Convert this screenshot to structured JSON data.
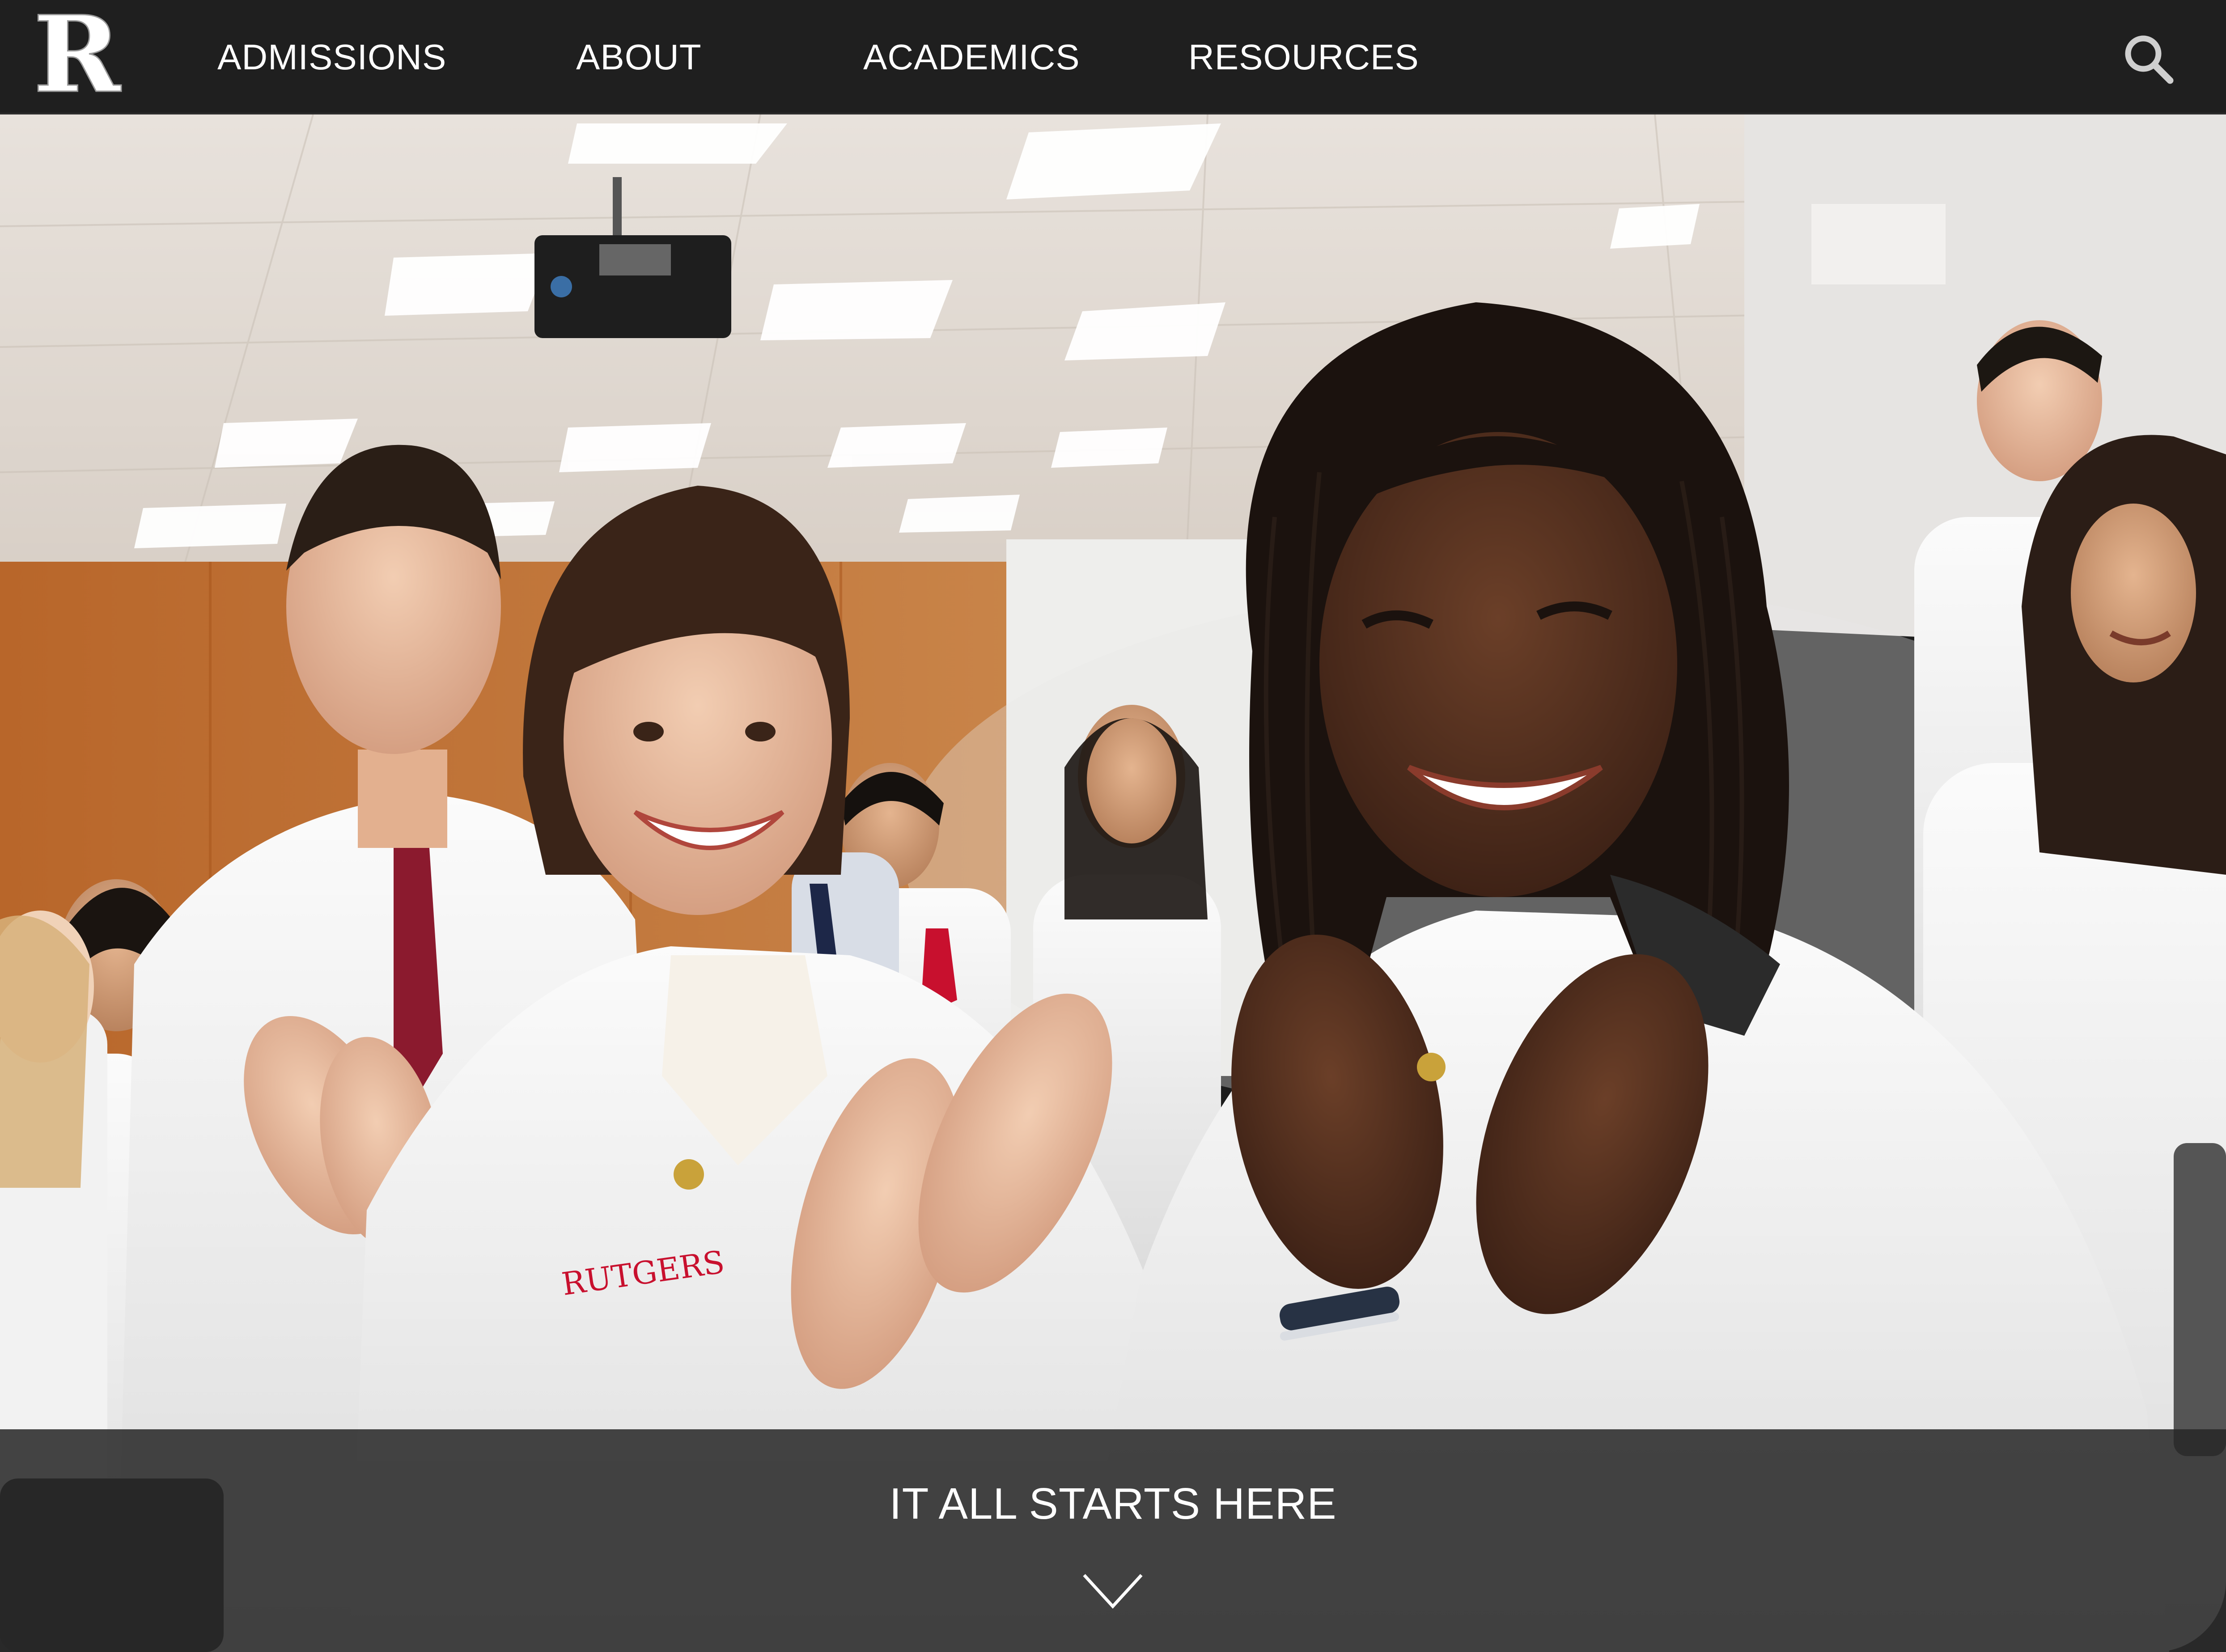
{
  "brand": {
    "logo_letter": "R",
    "logo_icon": "rutgers-r-logo"
  },
  "nav": {
    "items": [
      {
        "label": "ADMISSIONS"
      },
      {
        "label": "ABOUT"
      },
      {
        "label": "ACADEMICS"
      },
      {
        "label": "RESOURCES"
      }
    ],
    "search_icon": "search-icon"
  },
  "hero": {
    "image_subject": "photo",
    "caption": "IT ALL STARTS HERE",
    "scroll_icon": "chevron-down-icon"
  },
  "colors": {
    "nav_background": "#1f1f1f",
    "caption_background": "#262626",
    "text": "#ffffff",
    "accent_red": "#cc0033"
  }
}
